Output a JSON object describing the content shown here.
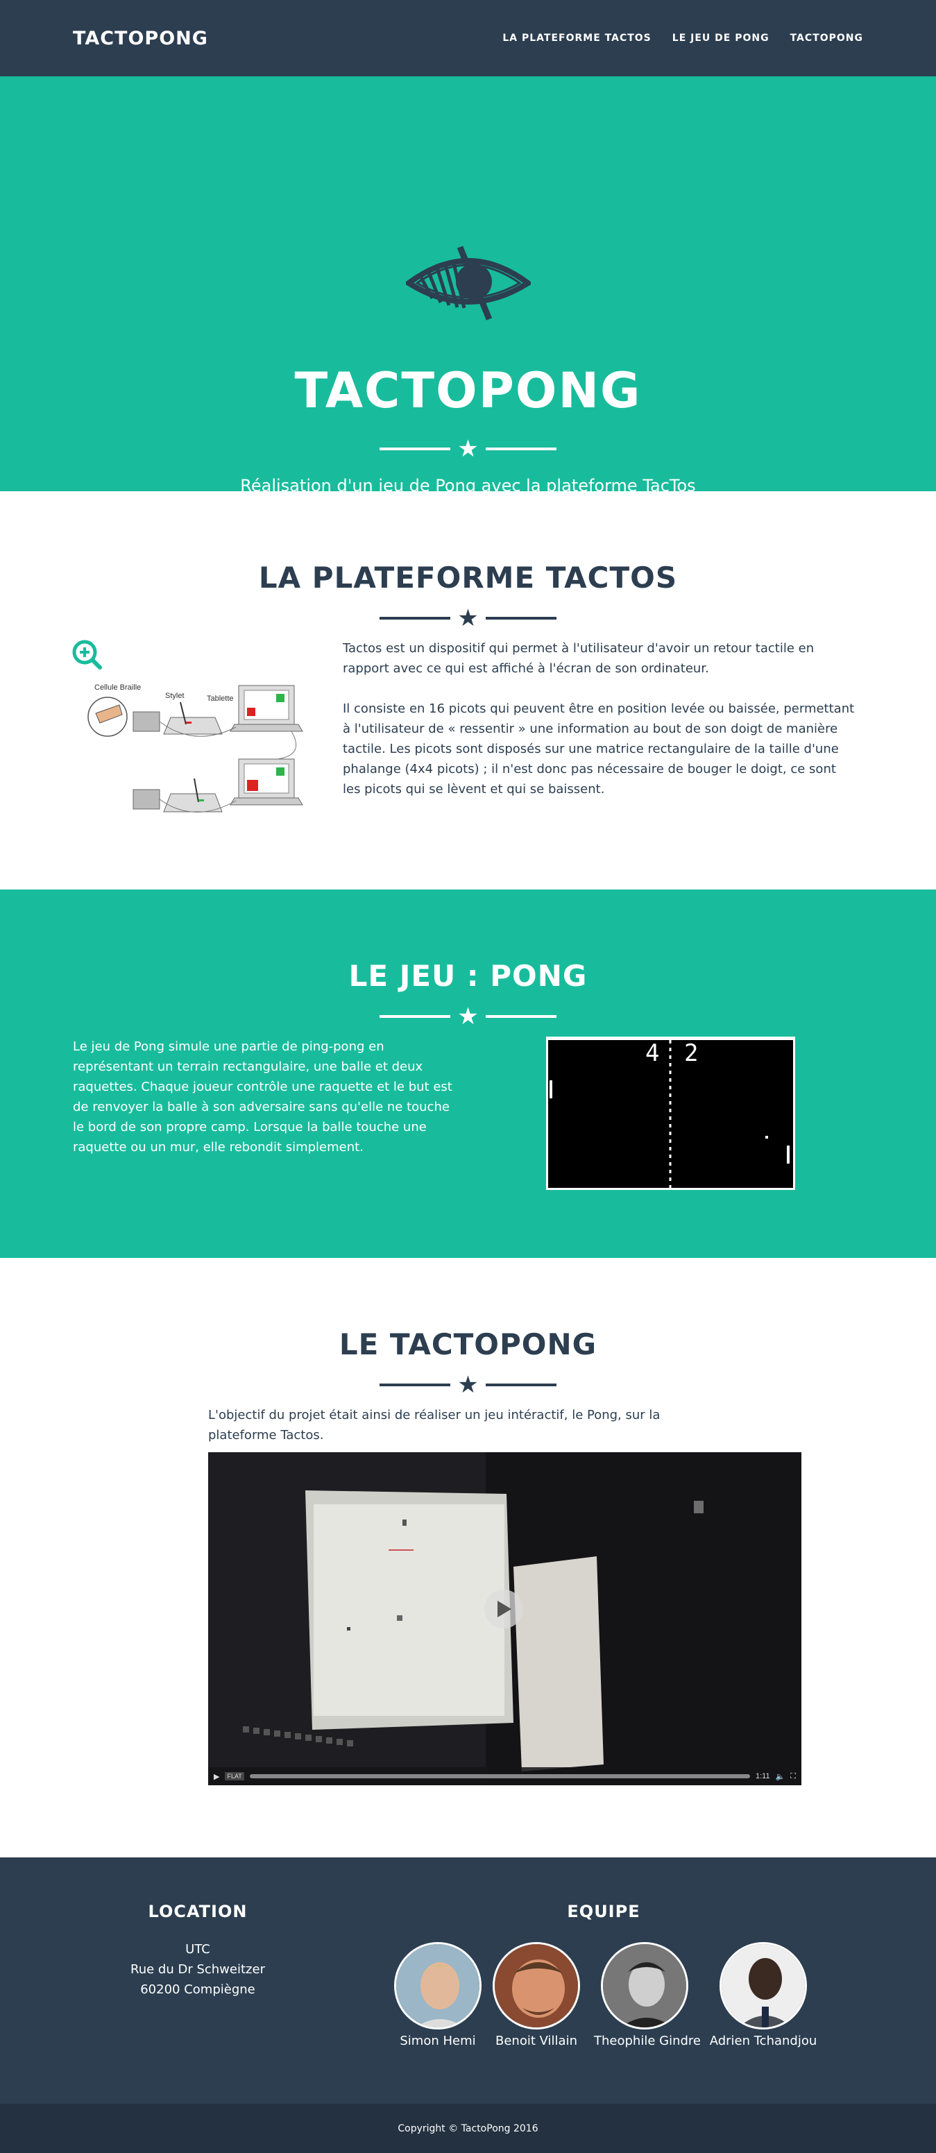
{
  "nav": {
    "brand": "TACTOPONG",
    "links": [
      "LA PLATEFORME TACTOS",
      "LE JEU DE PONG",
      "TACTOPONG"
    ]
  },
  "hero": {
    "title": "TACTOPONG",
    "subtitle": "Réalisation d'un jeu de Pong avec la plateforme TacTos"
  },
  "tactos": {
    "title": "LA PLATEFORME TACTOS",
    "diagram_labels": [
      "Cellule Braille",
      "Stylet",
      "Tablette"
    ],
    "paragraphs": [
      "Tactos est un dispositif qui permet à l'utilisateur d'avoir un retour tactile en rapport avec ce qui est affiché à l'écran de son ordinateur.",
      "Il consiste en 16 picots qui peuvent être en position levée ou baissée, permettant à l'utilisateur de « ressentir » une information au bout de son doigt de manière tactile. Les picots sont disposés sur une matrice rectangulaire de la taille d'une phalange (4x4 picots) ; il n'est donc pas nécessaire de bouger le doigt, ce sont les picots qui se lèvent et qui se baissent."
    ]
  },
  "pong": {
    "title": "LE JEU : PONG",
    "text": "Le jeu de Pong simule une partie de ping-pong en représentant un terrain rectangulaire, une balle et deux raquettes. Chaque joueur contrôle une raquette et le but est de renvoyer la balle à son adversaire sans qu'elle ne touche le bord de son propre camp. Lorsque la balle touche une raquette ou un mur, elle rebondit simplement.",
    "score_left": "4",
    "score_right": "2"
  },
  "tactopong": {
    "title": "LE TACTOPONG",
    "text": "L'objectif du projet était ainsi de réaliser un jeu intéractif, le Pong, sur la plateforme Tactos.",
    "video": {
      "time": "1:11",
      "badge": "FLAT"
    }
  },
  "footer": {
    "location_title": "LOCATION",
    "address": [
      "UTC",
      "Rue du Dr Schweitzer",
      "60200 Compiègne"
    ],
    "team_title": "EQUIPE",
    "members": [
      "Simon Hemi",
      "Benoit Villain",
      "Theophile Gindre",
      "Adrien Tchandjou"
    ]
  },
  "copyright": "Copyright © TactoPong 2016",
  "colors": {
    "primary": "#2c3e50",
    "accent": "#18bc9c"
  }
}
